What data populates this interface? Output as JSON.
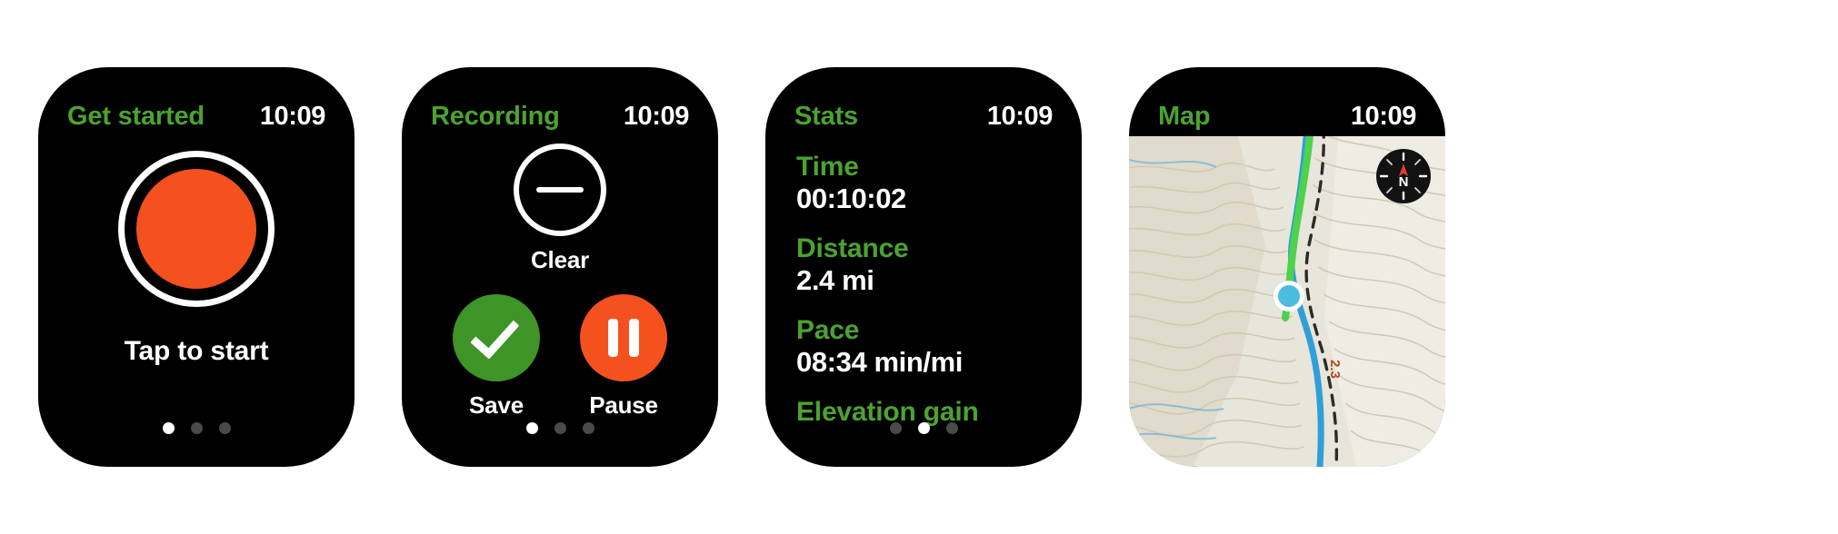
{
  "theme": {
    "background": "#ffffff",
    "watch_body": "#000000",
    "accent_green": "#4ba32f",
    "accent_orange": "#f4511e",
    "save_green": "#3f9428",
    "text_white": "#ffffff",
    "dot_inactive": "#4a4a4a"
  },
  "watches": [
    {
      "title": "Get started",
      "clock": "10:09",
      "record_label": "Tap to start",
      "dots": [
        true,
        false,
        false
      ]
    },
    {
      "title": "Recording",
      "clock": "10:09",
      "clear_label": "Clear",
      "save_label": "Save",
      "pause_label": "Pause",
      "dots": [
        true,
        false,
        false
      ]
    },
    {
      "title": "Stats",
      "clock": "10:09",
      "stats": [
        {
          "key": "Time",
          "value": "00:10:02"
        },
        {
          "key": "Distance",
          "value": "2.4 mi"
        },
        {
          "key": "Pace",
          "value": "08:34 min/mi"
        },
        {
          "key": "Elevation gain",
          "value": ""
        }
      ],
      "dots": [
        false,
        true,
        false
      ]
    },
    {
      "title": "Map",
      "clock": "10:09",
      "compass_label": "N",
      "trail_label": "2.3",
      "map_colors": {
        "terrain": "#e6e3d8",
        "contour": "#cfc9b6",
        "river": "#2f9fd8",
        "route_green": "#4cd24c",
        "trail_dashed": "#2b2b2b",
        "position_dot": "#4bbbe0"
      }
    }
  ]
}
